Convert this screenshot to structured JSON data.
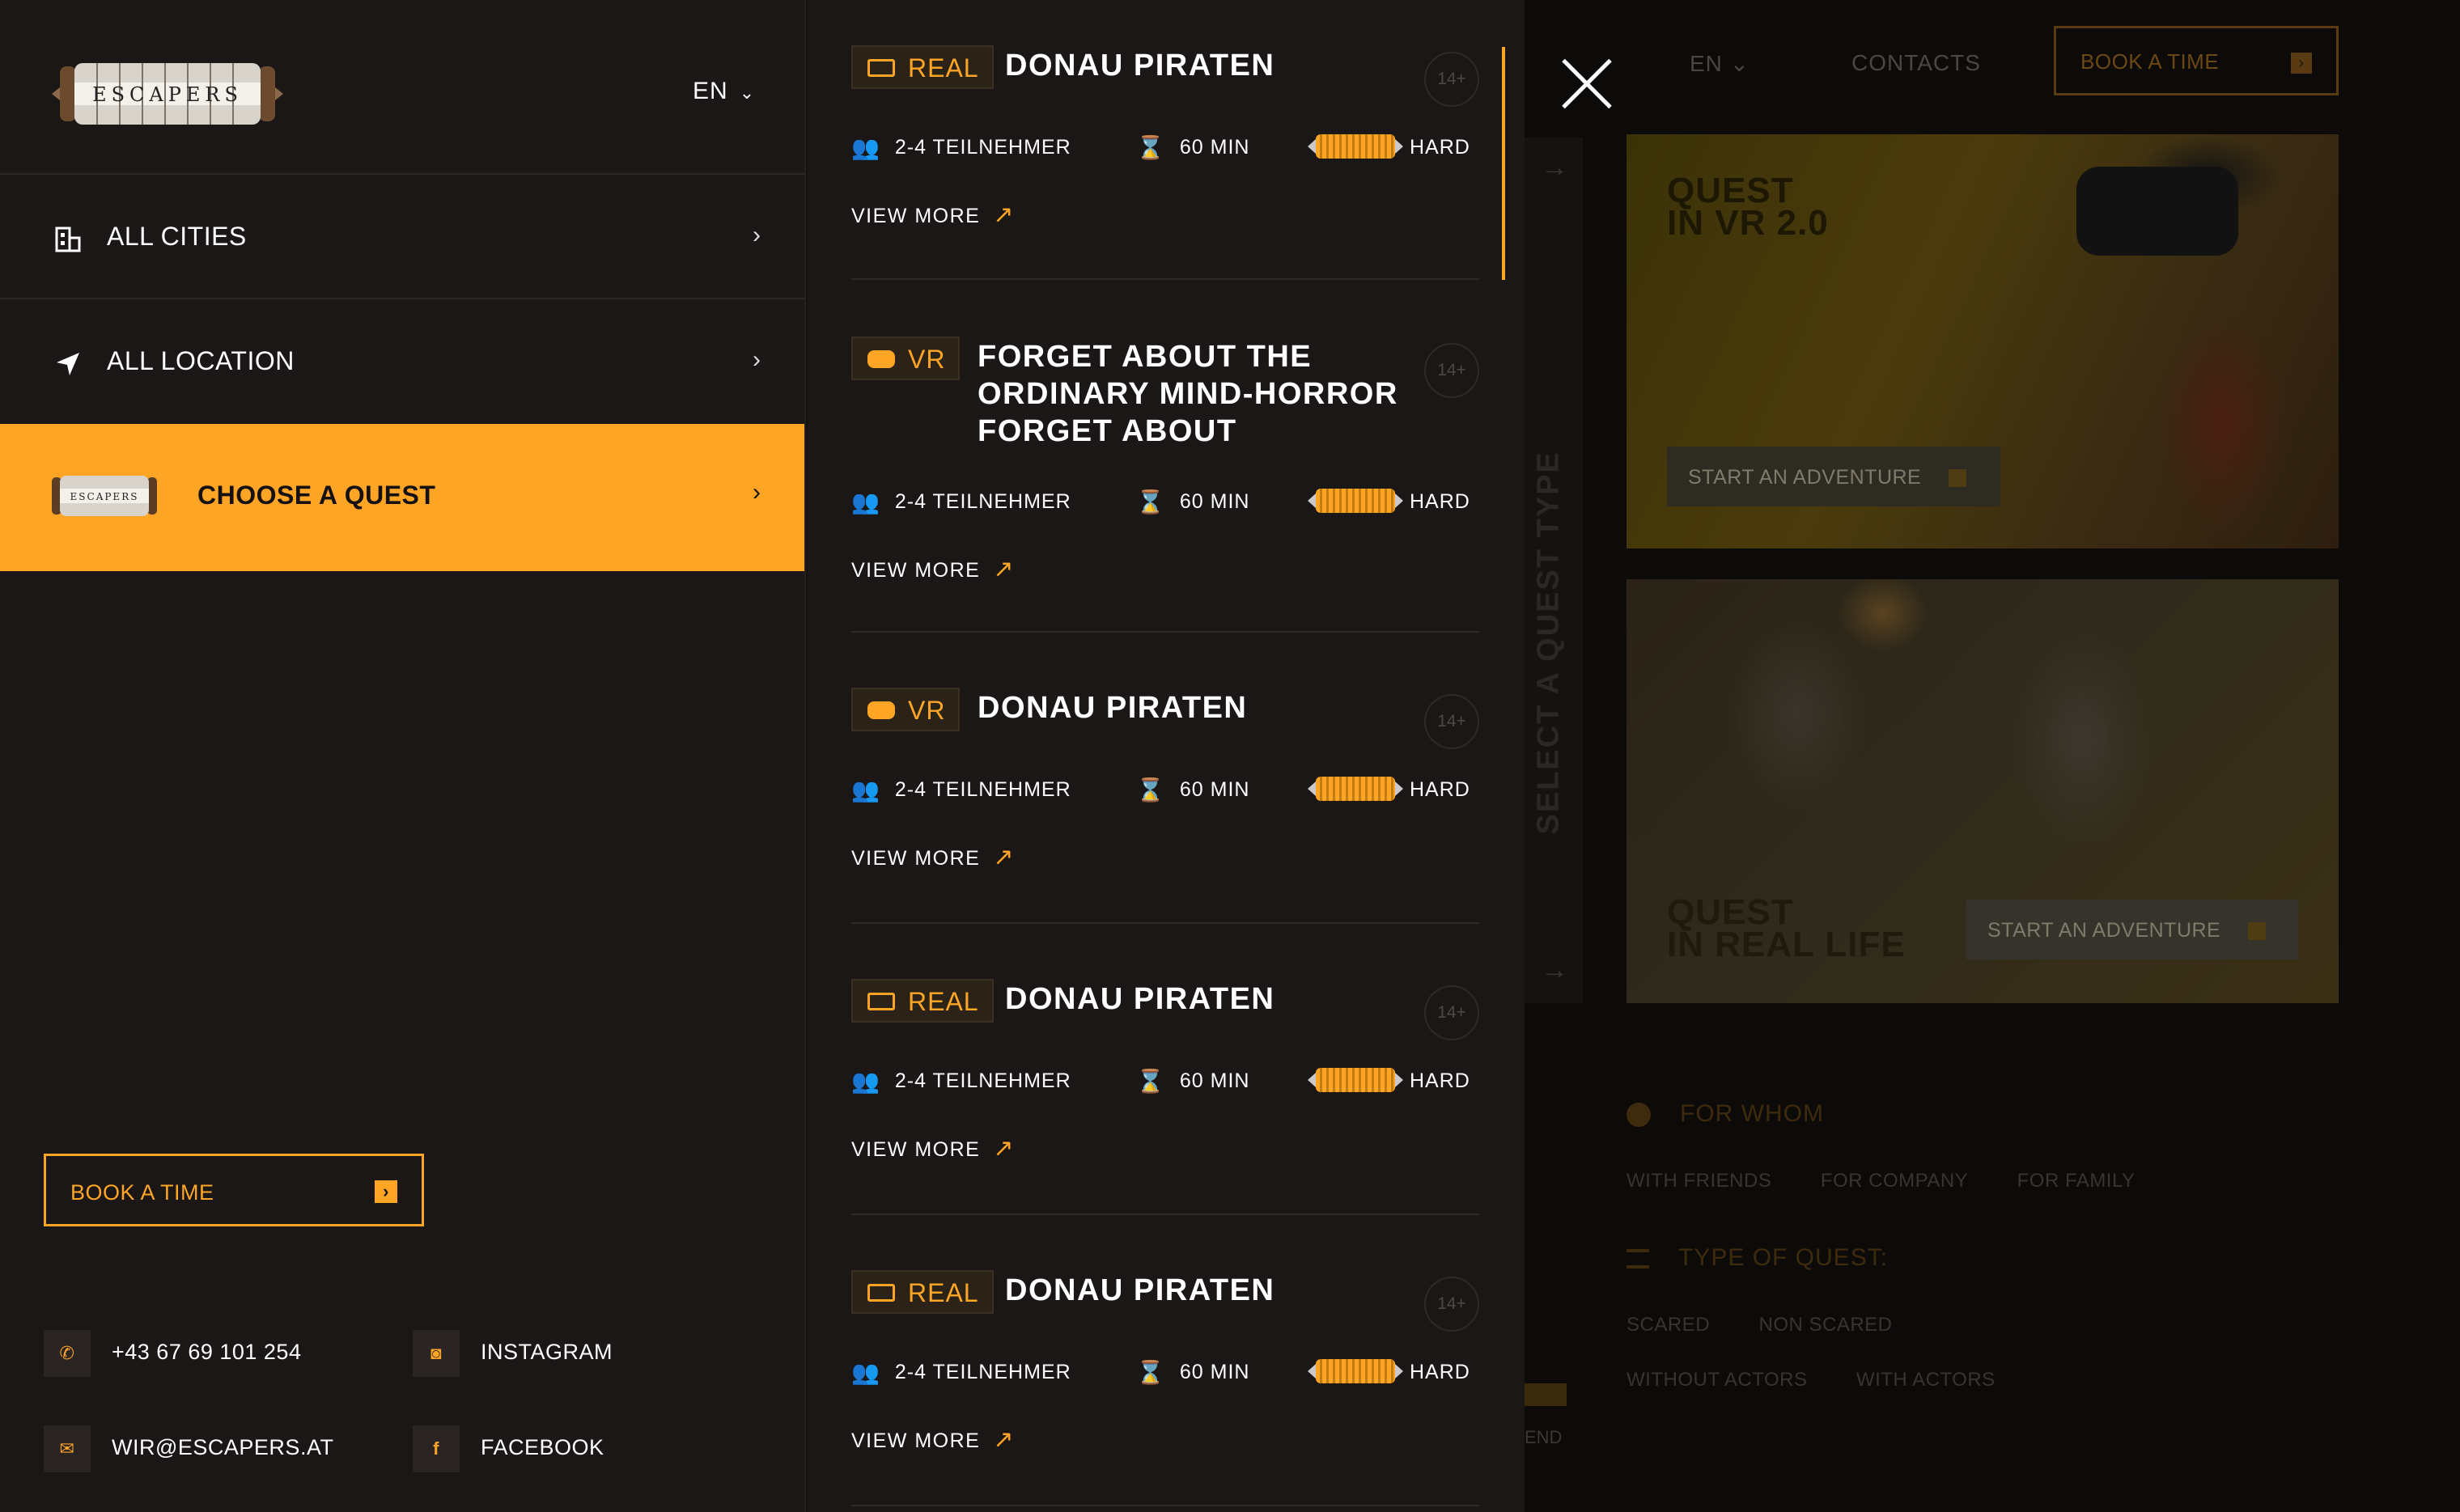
{
  "header": {
    "logo_text": "ESCAPERS",
    "language": "EN"
  },
  "menu": {
    "items": [
      {
        "label": "ALL CITIES",
        "icon": "building-icon"
      },
      {
        "label": "ALL LOCATION",
        "icon": "location-arrow-icon"
      },
      {
        "label": "CHOOSE A QUEST",
        "icon": "escapers-logo-icon"
      }
    ],
    "book_label": "BOOK A TIME",
    "contacts": {
      "phone": "+43 67 69 101 254",
      "email": "WIR@ESCAPERS.AT",
      "instagram": "INSTAGRAM",
      "facebook": "FACEBOOK"
    }
  },
  "quests": [
    {
      "type": "REAL",
      "title": "DONAU PIRATEN",
      "age": "14+",
      "participants": "2-4 TEILNEHMER",
      "duration": "60 MIN",
      "difficulty": "HARD",
      "more": "VIEW MORE"
    },
    {
      "type": "VR",
      "title": "FORGET ABOUT THE ORDINARY MIND-HORROR FORGET ABOUT",
      "age": "14+",
      "participants": "2-4 TEILNEHMER",
      "duration": "60 MIN",
      "difficulty": "HARD",
      "more": "VIEW MORE"
    },
    {
      "type": "VR",
      "title": "DONAU PIRATEN",
      "age": "14+",
      "participants": "2-4 TEILNEHMER",
      "duration": "60 MIN",
      "difficulty": "HARD",
      "more": "VIEW MORE"
    },
    {
      "type": "REAL",
      "title": "DONAU PIRATEN",
      "age": "14+",
      "participants": "2-4 TEILNEHMER",
      "duration": "60 MIN",
      "difficulty": "HARD",
      "more": "VIEW MORE"
    },
    {
      "type": "REAL",
      "title": "DONAU PIRATEN",
      "age": "14+",
      "participants": "2-4 TEILNEHMER",
      "duration": "60 MIN",
      "difficulty": "HARD",
      "more": "VIEW MORE"
    }
  ],
  "background": {
    "nav": {
      "language": "EN",
      "contacts": "CONTACTS",
      "book": "BOOK A TIME"
    },
    "rail_text": "SELECT A QUEST TYPE",
    "card_vr": {
      "title_line1": "QUEST",
      "title_line2": "IN VR 2.0",
      "button": "START AN ADVENTURE"
    },
    "card_real": {
      "title_line1": "QUEST",
      "title_line2": "IN REAL LIFE",
      "button": "START AN ADVENTURE"
    },
    "filters": {
      "for_whom": "FOR WHOM",
      "for_whom_options": [
        "WITH FRIENDS",
        "FOR COMPANY",
        "FOR FAMILY"
      ],
      "type_of_quest": "TYPE OF QUEST:",
      "type_options_row1": [
        "SCARED",
        "NON SCARED"
      ],
      "type_options_row2": [
        "WITHOUT ACTORS",
        "WITH ACTORS"
      ]
    },
    "end_fragment": "END"
  },
  "colors": {
    "accent": "#ffa526",
    "panel": "#1a1716",
    "background": "#0d0b0a"
  }
}
